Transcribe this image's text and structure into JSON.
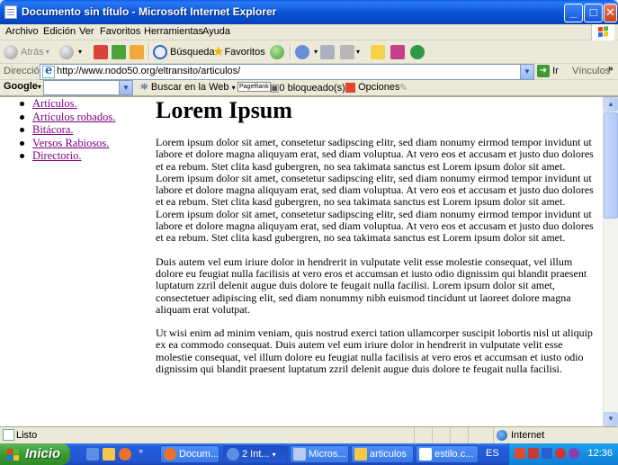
{
  "window": {
    "title": "Documento sin título - Microsoft Internet Explorer",
    "minimize": "_",
    "maximize": "□",
    "close": "✕"
  },
  "menu": [
    "Archivo",
    "Edición",
    "Ver",
    "Favoritos",
    "Herramientas",
    "Ayuda"
  ],
  "toolbar": {
    "back": "Atrás",
    "search": "Búsqueda",
    "favorites": "Favoritos"
  },
  "address": {
    "label": "Dirección",
    "url": "http://www.nodo50.org/eltransito/articulos/",
    "go": "Ir",
    "links": "Vínculos"
  },
  "google_bar": {
    "logo": "Google",
    "search_web": "Buscar en la Web",
    "pagerank": "PageRank",
    "blocked": "0 bloqueado(s)",
    "options": "Opciones"
  },
  "nav": [
    "Artículos.",
    "Artículos robados.",
    "Bitácora.",
    "Versos Rabiosos.",
    "Directorio."
  ],
  "content": {
    "heading": "Lorem Ipsum",
    "paragraphs": [
      "Lorem ipsum dolor sit amet, consetetur sadipscing elitr, sed diam nonumy eirmod tempor invidunt ut labore et dolore magna aliquyam erat, sed diam voluptua. At vero eos et accusam et justo duo dolores et ea rebum. Stet clita kasd gubergren, no sea takimata sanctus est Lorem ipsum dolor sit amet. Lorem ipsum dolor sit amet, consetetur sadipscing elitr, sed diam nonumy eirmod tempor invidunt ut labore et dolore magna aliquyam erat, sed diam voluptua. At vero eos et accusam et justo duo dolores et ea rebum. Stet clita kasd gubergren, no sea takimata sanctus est Lorem ipsum dolor sit amet. Lorem ipsum dolor sit amet, consetetur sadipscing elitr, sed diam nonumy eirmod tempor invidunt ut labore et dolore magna aliquyam erat, sed diam voluptua. At vero eos et accusam et justo duo dolores et ea rebum. Stet clita kasd gubergren, no sea takimata sanctus est Lorem ipsum dolor sit amet.",
      "Duis autem vel eum iriure dolor in hendrerit in vulputate velit esse molestie consequat, vel illum dolore eu feugiat nulla facilisis at vero eros et accumsan et iusto odio dignissim qui blandit praesent luptatum zzril delenit augue duis dolore te feugait nulla facilisi. Lorem ipsum dolor sit amet, consectetuer adipiscing elit, sed diam nonummy nibh euismod tincidunt ut laoreet dolore magna aliquam erat volutpat.",
      "Ut wisi enim ad minim veniam, quis nostrud exerci tation ullamcorper suscipit lobortis nisl ut aliquip ex ea commodo consequat. Duis autem vel eum iriure dolor in hendrerit in vulputate velit esse molestie consequat, vel illum dolore eu feugiat nulla facilisis at vero eros et accumsan et iusto odio dignissim qui blandit praesent luptatum zzril delenit augue duis dolore te feugait nulla facilisi."
    ]
  },
  "status": {
    "text": "Listo",
    "zone": "Internet"
  },
  "taskbar": {
    "start": "Inicio",
    "tasks": [
      "Docum...",
      "2 Int...",
      "Micros...",
      "articulos",
      "estilo.c..."
    ],
    "language": "ES",
    "clock": "12:36"
  }
}
